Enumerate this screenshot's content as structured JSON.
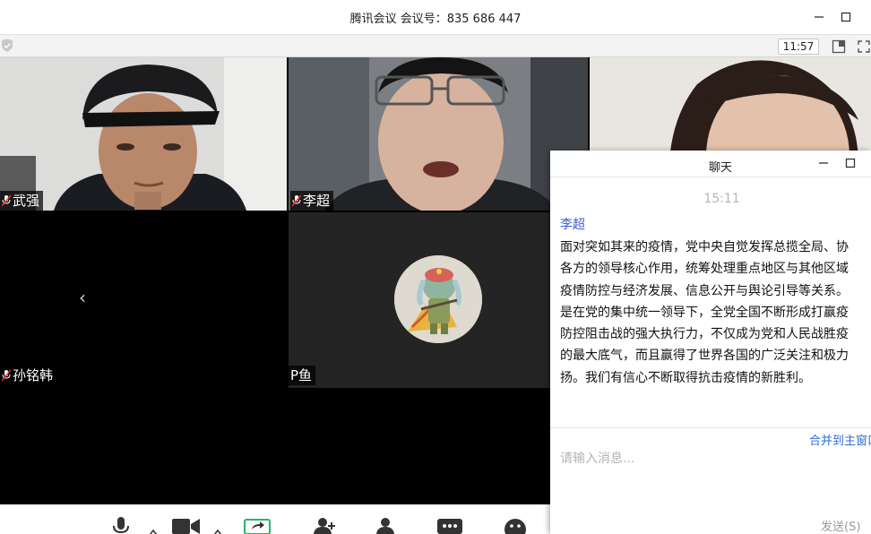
{
  "window": {
    "title": "腾讯会议 会议号：835 686 447",
    "minimize_icon": "minimize-icon",
    "maximize_icon": "maximize-icon"
  },
  "toolbar": {
    "clock": "11:57",
    "icons": [
      "shield-icon",
      "layout-icon",
      "fullscreen-icon"
    ]
  },
  "participants": [
    {
      "name": "武强",
      "muted": true
    },
    {
      "name": "李超",
      "muted": true
    },
    {
      "name": "",
      "muted": false
    },
    {
      "name": "孙铭韩",
      "muted": true
    },
    {
      "name": "P鱼",
      "muted": false
    }
  ],
  "bottom_bar": {
    "icons": [
      "microphone-icon",
      "chevron-up-icon",
      "camera-icon",
      "chevron-up-icon",
      "share-screen-icon",
      "invite-icon",
      "members-icon",
      "chat-icon",
      "emoji-icon"
    ]
  },
  "chat": {
    "title": "聊天",
    "timestamp": "15:11",
    "sender": "李超",
    "message_lines": [
      "面对突如其来的疫情，党中央自觉发挥总揽全局、协",
      "各方的领导核心作用，统筹处理重点地区与其他区域",
      "疫情防控与经济发展、信息公开与舆论引导等关系。",
      "是在党的集中统一领导下，全党全国不断形成打赢疫",
      "防控阻击战的强大执行力，不仅成为党和人民战胜疫",
      "的最大底气，而且赢得了世界各国的广泛关注和极力",
      "扬。我们有信心不断取得抗击疫情的新胜利。"
    ],
    "merge_link": "合并到主窗口",
    "input_placeholder": "请输入消息...",
    "send_button": "发送(S)"
  },
  "colors": {
    "chat_sender": "#3a5bd6",
    "merge_link": "#2a6fd6",
    "tile_gray": "#242424"
  }
}
